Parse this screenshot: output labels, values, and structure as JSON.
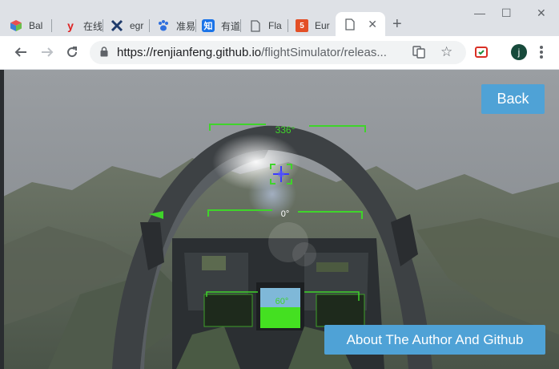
{
  "browser": {
    "tabs": [
      {
        "label": "Bal",
        "icon": "cube-favicon-icon"
      },
      {
        "label": "在线",
        "icon": "yoyo-favicon-icon"
      },
      {
        "label": "egr",
        "icon": "crossed-tools-favicon-icon"
      },
      {
        "label": "准易",
        "icon": "baidu-paw-favicon-icon"
      },
      {
        "label": "有道",
        "icon": "zhihu-favicon-icon"
      },
      {
        "label": "Fla",
        "icon": "document-favicon-icon"
      },
      {
        "label": "Eur",
        "icon": "html5-favicon-icon"
      },
      {
        "label": "",
        "icon": "document-favicon-icon",
        "active": true
      }
    ],
    "url_host": "https://renjianfeng.github.io",
    "url_path": "/flightSimulator/releas...",
    "profile_initial": "j"
  },
  "hud": {
    "heading": "336°",
    "pitch": "0°",
    "lower_readout": "60°"
  },
  "buttons": {
    "back": "Back",
    "about": "About The Author And Github"
  },
  "colors": {
    "button_bg": "#4fa2d6",
    "hud_green": "#3fd42a",
    "reticle_blue": "#3a3aff"
  }
}
